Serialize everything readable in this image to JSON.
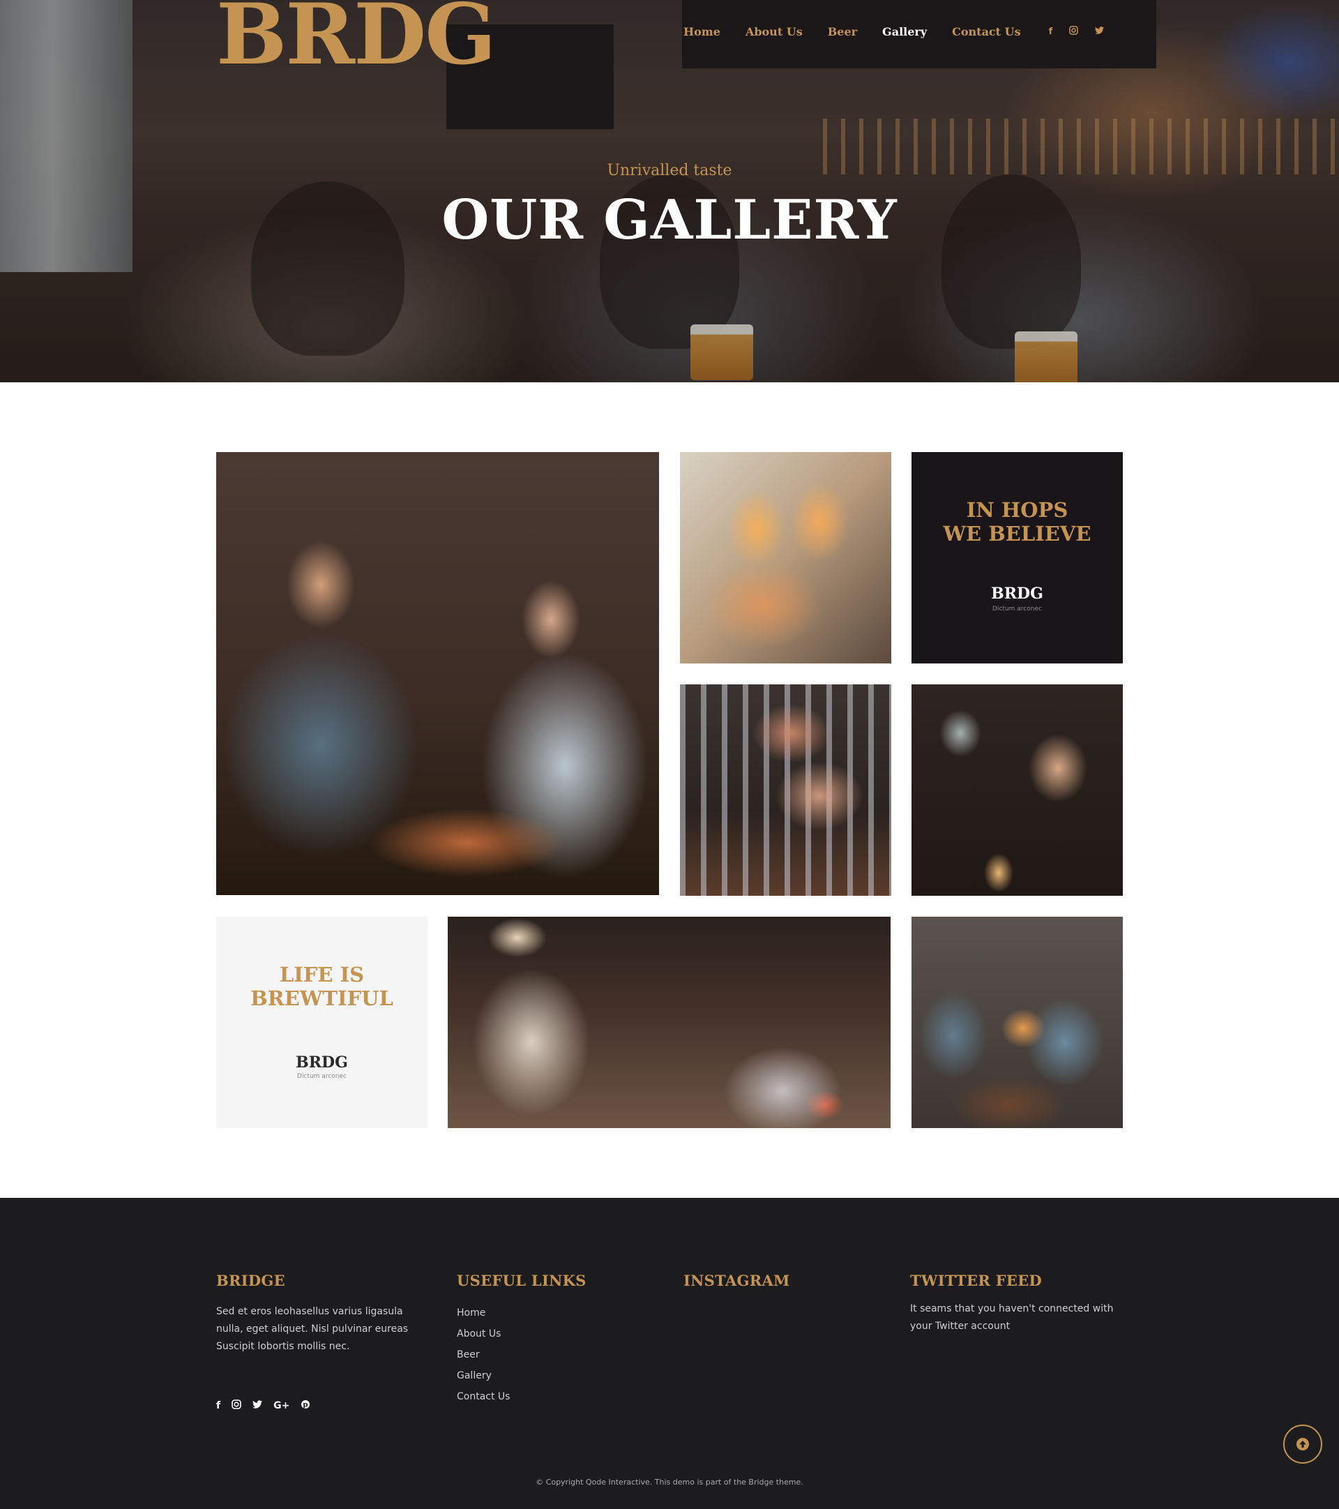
{
  "brand": {
    "logo": "BRDG",
    "accent": "#c69452"
  },
  "nav": {
    "items": [
      "Home",
      "About Us",
      "Beer",
      "Gallery",
      "Contact Us"
    ],
    "active": "Gallery",
    "social_icons": [
      "facebook-icon",
      "instagram-icon",
      "twitter-icon"
    ]
  },
  "hero": {
    "subtitle": "Unrivalled taste",
    "title": "OUR GALLERY"
  },
  "gallery": {
    "hops_card": {
      "line1": "IN HOPS",
      "line2": "WE BELIEVE",
      "brand": "BRDG",
      "tagline": "Dictum arconec"
    },
    "life_card": {
      "line1": "LIFE IS",
      "line2": "BREWTIFUL",
      "brand": "BRDG",
      "tagline": "Dictum arconec"
    }
  },
  "footer": {
    "bridge": {
      "heading": "BRIDGE",
      "text": "Sed et eros leohasellus varius ligasula nulla, eget aliquet. Nisl pulvinar eureas Suscipit lobortis mollis nec.",
      "social_icons": [
        "facebook-icon",
        "instagram-icon",
        "twitter-icon",
        "google-plus-icon",
        "pinterest-icon"
      ]
    },
    "links": {
      "heading": "USEFUL LINKS",
      "items": [
        "Home",
        "About Us",
        "Beer",
        "Gallery",
        "Contact Us"
      ]
    },
    "instagram": {
      "heading": "INSTAGRAM"
    },
    "twitter": {
      "heading": "TWITTER FEED",
      "text": "It seams that you haven't connected with your Twitter account"
    },
    "copyright": "© Copyright Qode Interactive. This demo is part of the Bridge theme."
  }
}
